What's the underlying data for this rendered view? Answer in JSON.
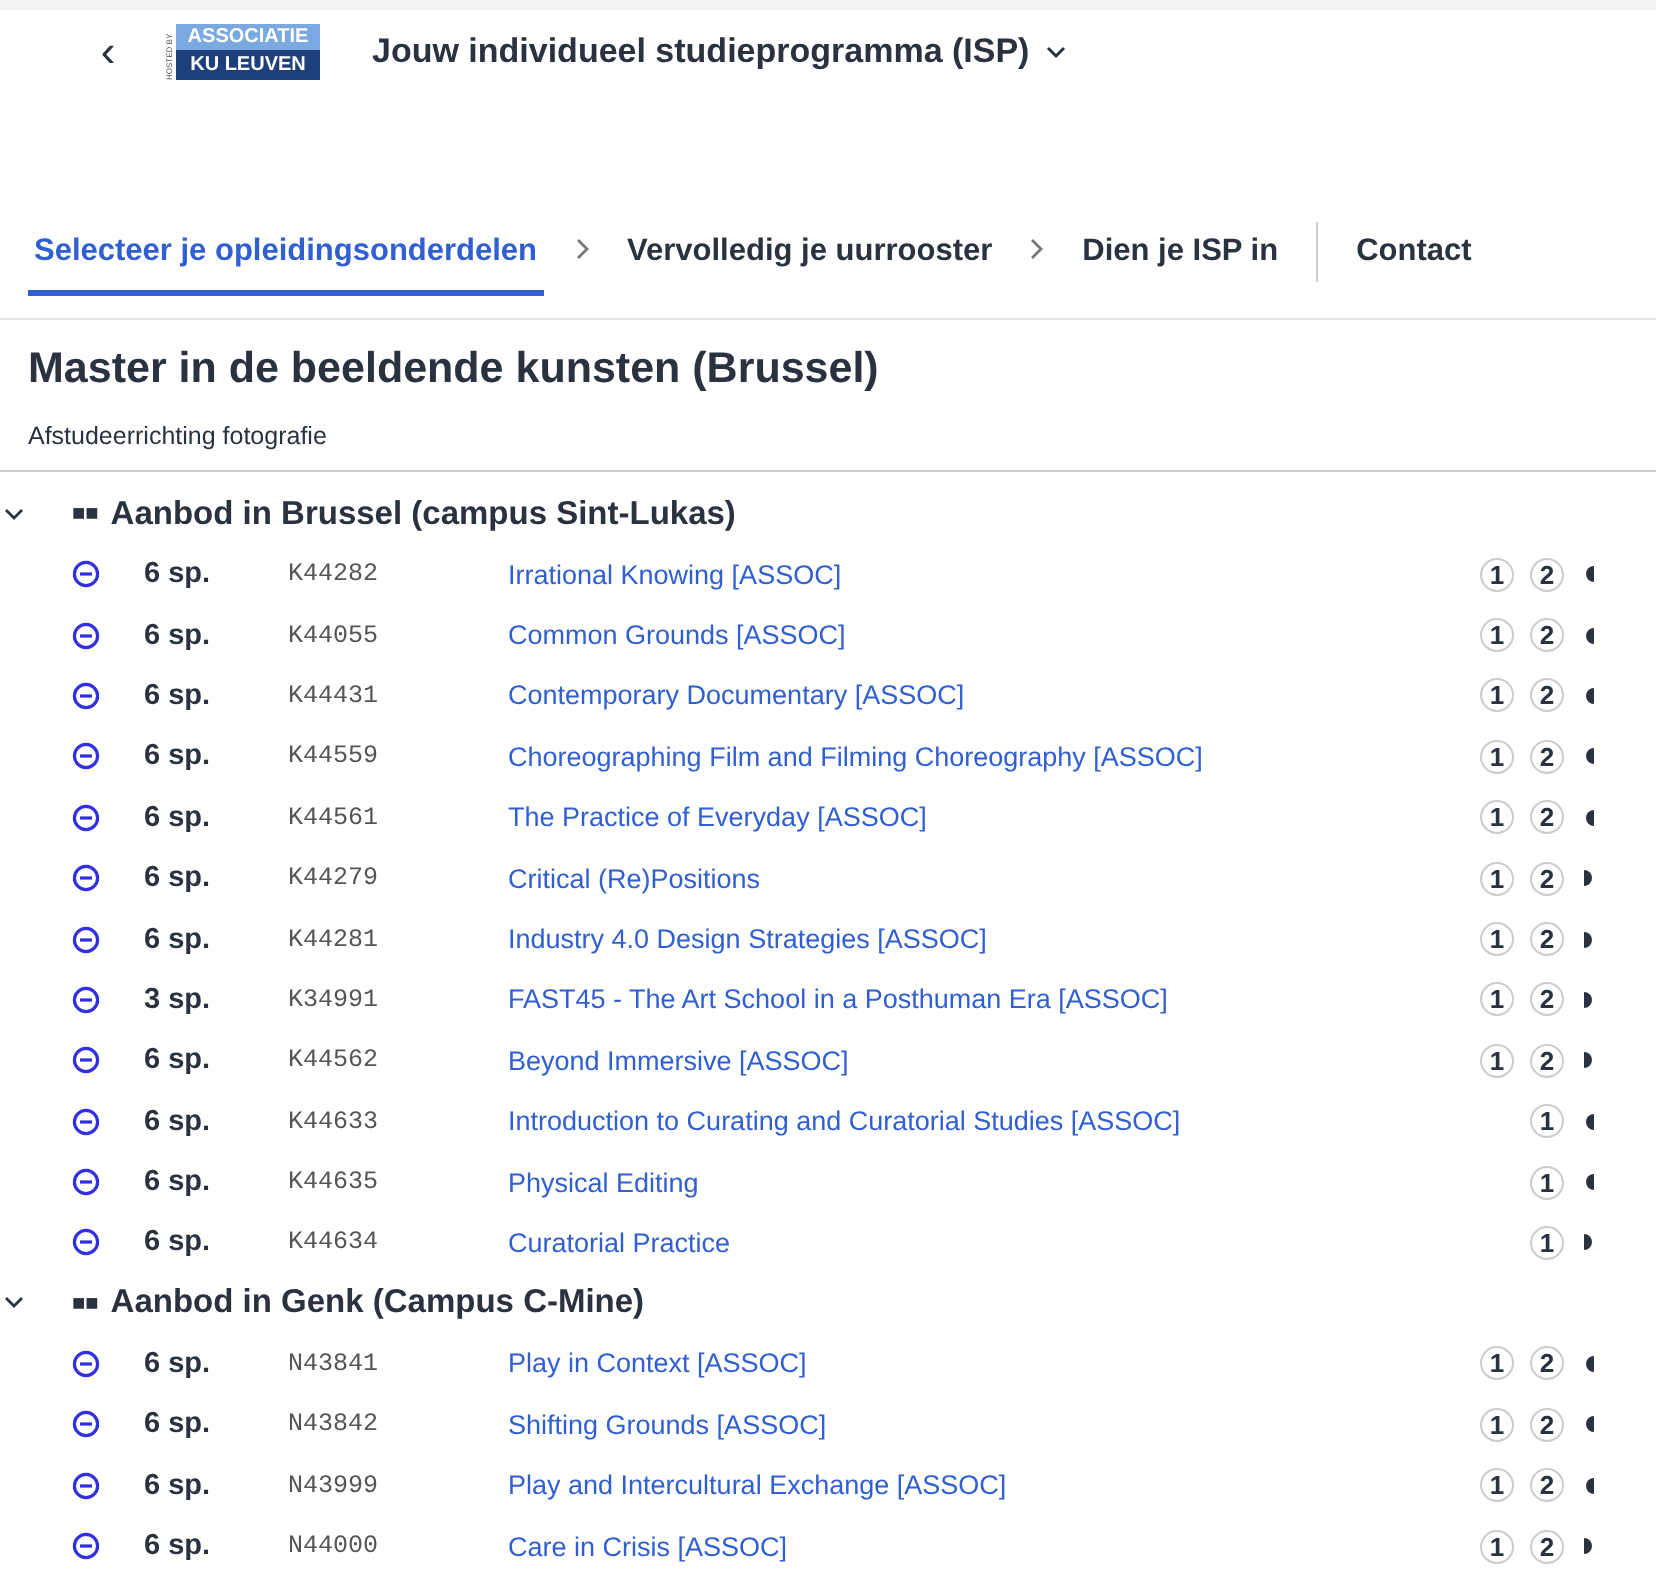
{
  "header": {
    "back": "‹",
    "logo_top": "ASSOCIATIE",
    "logo_bottom": "KU LEUVEN",
    "logo_side": "HOSTED BY",
    "title": "Jouw individueel studieprogramma (ISP)"
  },
  "steps": [
    {
      "label": "Selecteer je opleidingsonderdelen",
      "selected": true
    },
    {
      "label": "Vervolledig je uurrooster",
      "selected": false
    },
    {
      "label": "Dien je ISP in",
      "selected": false
    },
    {
      "label": "Contact",
      "selected": false
    }
  ],
  "program": {
    "title": "Master in de beeldende kunsten (Brussel)",
    "subtitle": "Afstudeerrichting fotografie"
  },
  "groups": [
    {
      "title": "Aanbod in Brussel (campus Sint-Lukas)",
      "marker": "■■",
      "expanded": true,
      "courses": [
        {
          "credits": "6 sp.",
          "code": "K44282",
          "name": "Irrational Knowing [ASSOC]",
          "semesters": [
            "1",
            "2"
          ],
          "kind": "left"
        },
        {
          "credits": "6 sp.",
          "code": "K44055",
          "name": "Common Grounds [ASSOC]",
          "semesters": [
            "1",
            "2"
          ],
          "kind": "left"
        },
        {
          "credits": "6 sp.",
          "code": "K44431",
          "name": "Contemporary Documentary [ASSOC]",
          "semesters": [
            "1",
            "2"
          ],
          "kind": "left"
        },
        {
          "credits": "6 sp.",
          "code": "K44559",
          "name": "Choreographing Film and Filming Choreography [ASSOC]",
          "semesters": [
            "1",
            "2"
          ],
          "kind": "left"
        },
        {
          "credits": "6 sp.",
          "code": "K44561",
          "name": "The Practice of Everyday [ASSOC]",
          "semesters": [
            "1",
            "2"
          ],
          "kind": "left"
        },
        {
          "credits": "6 sp.",
          "code": "K44279",
          "name": "Critical (Re)Positions",
          "semesters": [
            "1",
            "2"
          ],
          "kind": "right"
        },
        {
          "credits": "6 sp.",
          "code": "K44281",
          "name": "Industry 4.0 Design Strategies [ASSOC]",
          "semesters": [
            "1",
            "2"
          ],
          "kind": "right"
        },
        {
          "credits": "3 sp.",
          "code": "K34991",
          "name": "FAST45 - The Art School in a Posthuman Era [ASSOC]",
          "semesters": [
            "1",
            "2"
          ],
          "kind": "right"
        },
        {
          "credits": "6 sp.",
          "code": "K44562",
          "name": "Beyond Immersive [ASSOC]",
          "semesters": [
            "1",
            "2"
          ],
          "kind": "right"
        },
        {
          "credits": "6 sp.",
          "code": "K44633",
          "name": "Introduction to Curating and Curatorial Studies [ASSOC]",
          "semesters": [
            "1"
          ],
          "kind": "left"
        },
        {
          "credits": "6 sp.",
          "code": "K44635",
          "name": "Physical Editing",
          "semesters": [
            "1"
          ],
          "kind": "left"
        },
        {
          "credits": "6 sp.",
          "code": "K44634",
          "name": "Curatorial Practice",
          "semesters": [
            "1"
          ],
          "kind": "right"
        }
      ]
    },
    {
      "title": "Aanbod in Genk (Campus C-Mine)",
      "marker": "■■",
      "expanded": true,
      "courses": [
        {
          "credits": "6 sp.",
          "code": "N43841",
          "name": "Play in Context [ASSOC]",
          "semesters": [
            "1",
            "2"
          ],
          "kind": "left"
        },
        {
          "credits": "6 sp.",
          "code": "N43842",
          "name": "Shifting Grounds [ASSOC]",
          "semesters": [
            "1",
            "2"
          ],
          "kind": "left"
        },
        {
          "credits": "6 sp.",
          "code": "N43999",
          "name": "Play and Intercultural Exchange [ASSOC]",
          "semesters": [
            "1",
            "2"
          ],
          "kind": "left"
        },
        {
          "credits": "6 sp.",
          "code": "N44000",
          "name": "Care in Crisis [ASSOC]",
          "semesters": [
            "1",
            "2"
          ],
          "kind": "right"
        }
      ]
    }
  ]
}
